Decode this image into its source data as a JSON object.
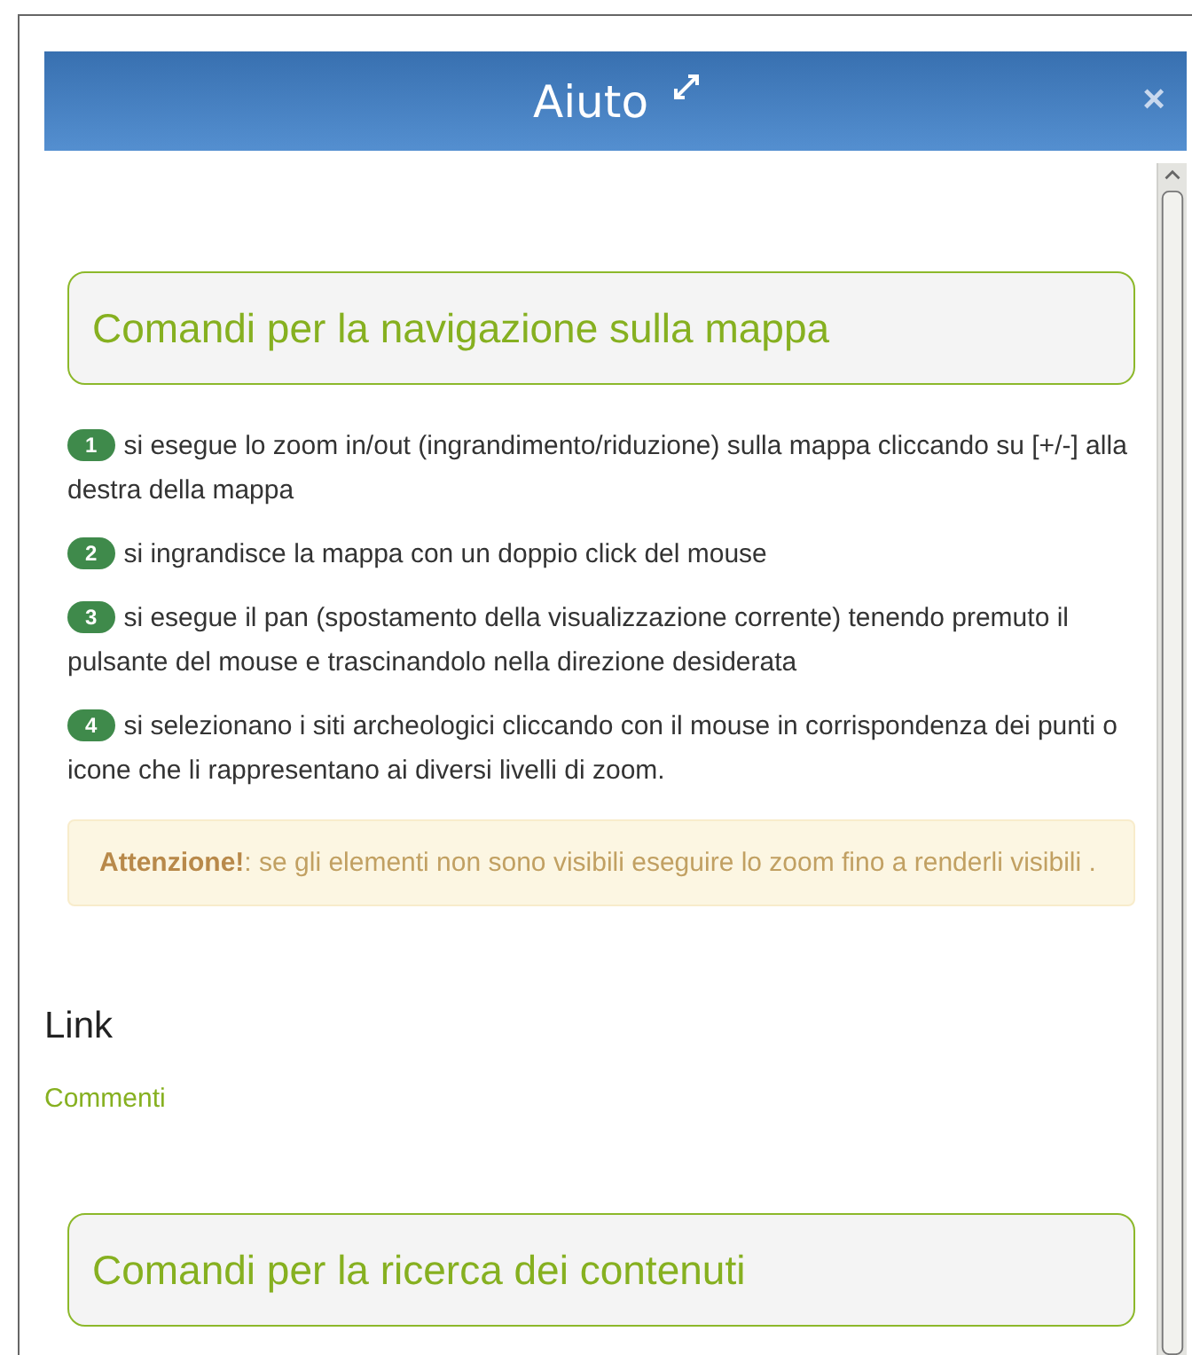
{
  "dialog": {
    "title": "Aiuto",
    "close_label": "×"
  },
  "sections": [
    {
      "kind": "panel",
      "title": "Comandi per la navigazione sulla mappa",
      "steps": [
        {
          "number": "1",
          "text": "si esegue lo zoom in/out (ingrandimento/riduzione) sulla mappa cliccando su [+/-] alla destra della mappa"
        },
        {
          "number": "2",
          "text": "si ingrandisce la mappa con un doppio click del mouse"
        },
        {
          "number": "3",
          "text": "si esegue il pan (spostamento della visualizzazione corrente) tenendo premuto il pulsante del mouse e trascinandolo nella direzione desiderata"
        },
        {
          "number": "4",
          "text": "si selezionano i siti archeologici cliccando con il mouse in corrispondenza dei punti o icone che li rappresentano ai diversi livelli di zoom."
        }
      ],
      "warning": "**Attenzione!**: se gli elementi non sono visibili eseguire lo zoom fino a renderli visibili ."
    },
    {
      "kind": "links",
      "title": "Link",
      "links": [
        "Commenti"
      ]
    },
    {
      "kind": "panel",
      "title": "Comandi per la ricerca dei contenuti"
    }
  ]
}
